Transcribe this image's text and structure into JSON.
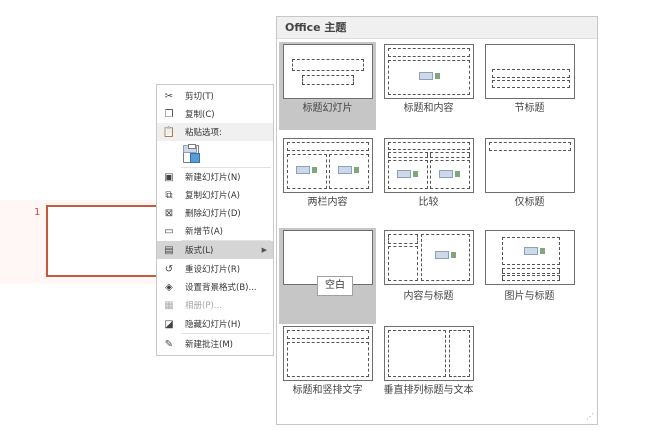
{
  "slide": {
    "number": "1"
  },
  "context_menu": {
    "items": [
      {
        "label": "剪切(T)",
        "icon": "scissors-icon"
      },
      {
        "label": "复制(C)",
        "icon": "copy-icon"
      },
      {
        "label": "粘贴选项:",
        "icon": "paste-icon"
      },
      {
        "label": "新建幻灯片(N)",
        "icon": "new-slide-icon"
      },
      {
        "label": "复制幻灯片(A)",
        "icon": "duplicate-slide-icon"
      },
      {
        "label": "删除幻灯片(D)",
        "icon": "delete-slide-icon"
      },
      {
        "label": "新增节(A)",
        "icon": "add-section-icon"
      },
      {
        "label": "版式(L)",
        "icon": "layout-icon"
      },
      {
        "label": "重设幻灯片(R)",
        "icon": "reset-slide-icon"
      },
      {
        "label": "设置背景格式(B)...",
        "icon": "format-background-icon"
      },
      {
        "label": "相册(P)...",
        "icon": "photo-album-icon"
      },
      {
        "label": "隐藏幻灯片(H)",
        "icon": "hide-slide-icon"
      },
      {
        "label": "新建批注(M)",
        "icon": "new-comment-icon"
      }
    ]
  },
  "layout_gallery": {
    "title": "Office 主题",
    "tooltip": "空白",
    "layouts": [
      "标题幻灯片",
      "标题和内容",
      "节标题",
      "两栏内容",
      "比较",
      "仅标题",
      "空白",
      "内容与标题",
      "图片与标题",
      "标题和竖排文字",
      "垂直排列标题与文本"
    ]
  }
}
